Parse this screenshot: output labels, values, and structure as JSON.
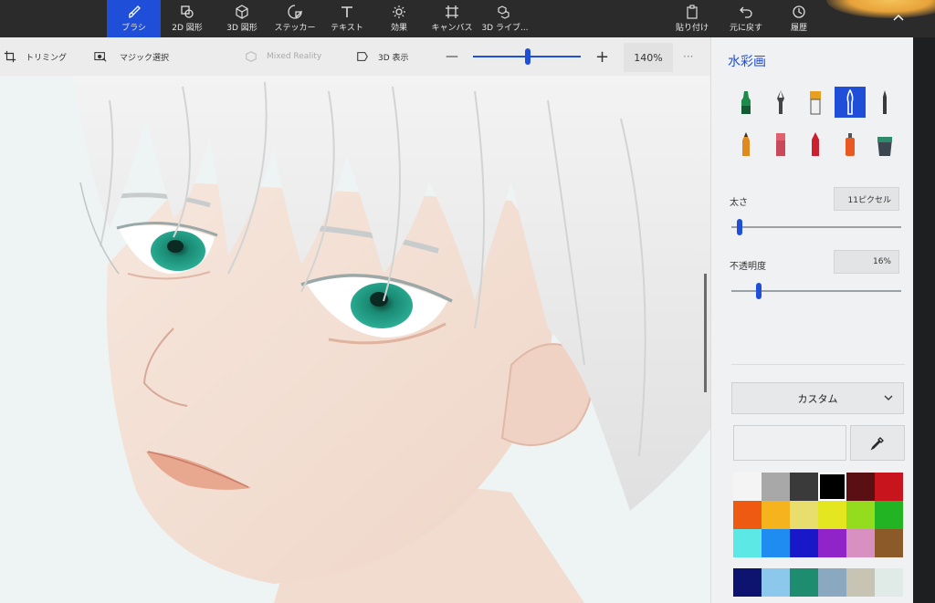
{
  "topbar": {
    "tools": [
      {
        "label": "ブラシ",
        "icon": "brush-icon",
        "active": true
      },
      {
        "label": "2D 図形",
        "icon": "shapes-2d-icon"
      },
      {
        "label": "3D 図形",
        "icon": "cube-icon"
      },
      {
        "label": "ステッカー",
        "icon": "sticker-icon"
      },
      {
        "label": "テキスト",
        "icon": "text-icon"
      },
      {
        "label": "効果",
        "icon": "effects-sun-icon"
      },
      {
        "label": "キャンバス",
        "icon": "canvas-grid-icon"
      },
      {
        "label": "3D ライブ...",
        "icon": "library-3d-icon"
      }
    ],
    "actions": [
      {
        "label": "貼り付け",
        "icon": "paste-icon"
      },
      {
        "label": "元に戻す",
        "icon": "undo-icon"
      },
      {
        "label": "履歴",
        "icon": "history-icon"
      }
    ],
    "collapse_icon": "chevron-up-icon",
    "accent": "#1f4fd8"
  },
  "toolbar": {
    "crop_label": "トリミング",
    "magic_select_label": "マジック選択",
    "mixed_reality_label": "Mixed Reality",
    "view3d_label": "3D 表示",
    "zoom_minus": "—",
    "zoom_plus": "+",
    "zoom_value": "140%",
    "more_label": "···"
  },
  "panel": {
    "title": "水彩画",
    "brushes": [
      {
        "name": "marker-icon",
        "color": "#1e8a4c"
      },
      {
        "name": "calligraphy-pen-icon",
        "color": "#3a3a3a"
      },
      {
        "name": "oil-brush-icon",
        "color": "#e8a020"
      },
      {
        "name": "watercolor-brush-icon",
        "color": "#ffffff",
        "active": true
      },
      {
        "name": "pixel-pen-icon",
        "color": "#3a3a3a"
      },
      {
        "name": "pencil-icon",
        "color": "#e08a1e"
      },
      {
        "name": "eraser-icon",
        "color": "#e06070"
      },
      {
        "name": "crayon-icon",
        "color": "#cc2030"
      },
      {
        "name": "spray-can-icon",
        "color": "#e85a20"
      },
      {
        "name": "fill-bucket-icon",
        "color": "#2d8a6a"
      }
    ],
    "size_label": "太さ",
    "size_value": "11ピクセル",
    "size_level": 0.05,
    "opacity_label": "不透明度",
    "opacity_value": "16%",
    "opacity_level": 0.16,
    "palette_dropdown": "カスタム",
    "eyedropper_icon": "eyedropper-icon",
    "palette": [
      "#f4f4f4",
      "#a8a8a8",
      "#3a3a3a",
      "#000000",
      "#5a0f12",
      "#c8141c",
      "#ee5a12",
      "#f5b41e",
      "#e8de6e",
      "#e4e620",
      "#94dc1e",
      "#22b422",
      "#5ce8e4",
      "#1e8cf0",
      "#1818c8",
      "#9024c8",
      "#d890c0",
      "#8c5a28"
    ],
    "custom_colors": [
      "#0c1470",
      "#8cc8ec",
      "#1e8c6e",
      "#8aa8c0",
      "#c8c4b4",
      "#e0ebe8"
    ]
  }
}
